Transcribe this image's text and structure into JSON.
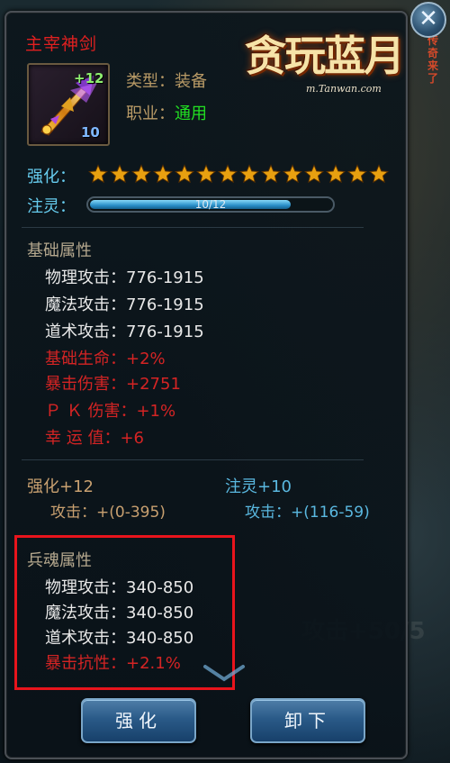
{
  "close_glyph": "✕",
  "logo": {
    "main": "贪玩蓝月",
    "url": "m.Tanwan.com",
    "side": "传奇来了"
  },
  "item": {
    "name": "主宰神剑",
    "enhance_badge": "+12",
    "level_badge": "10",
    "type_label": "类型：",
    "type_value": "装备",
    "class_label": "职业：",
    "class_value": "通用"
  },
  "enhance": {
    "label": "强化：",
    "stars": 14,
    "star_color": "#e8a010"
  },
  "infuse": {
    "label": "注灵：",
    "progress_text": "10/12",
    "progress": 0.833
  },
  "base_section": {
    "title": "基础属性",
    "base_attrs": [
      {
        "label": "物理攻击：",
        "value": "776-1915"
      },
      {
        "label": "魔法攻击：",
        "value": "776-1915"
      },
      {
        "label": "道术攻击：",
        "value": "776-1915"
      }
    ],
    "bonus_attrs": [
      {
        "label": "基础生命：",
        "value": "+2%"
      },
      {
        "label": "暴击伤害：",
        "value": "+2751"
      },
      {
        "label": "Ｐ Ｋ 伤害：",
        "value": "+1%"
      },
      {
        "label": "幸 运 值：",
        "value": "+6"
      }
    ]
  },
  "bonus": {
    "enhance_head": "强化+12",
    "enhance_line": "攻击：+(0-395)",
    "infuse_head": "注灵+10",
    "infuse_line": "攻击：+(116-59)"
  },
  "soul_section": {
    "title": "兵魂属性",
    "attrs": [
      {
        "label": "物理攻击：",
        "value": "340-850"
      },
      {
        "label": "魔法攻击：",
        "value": "340-850"
      },
      {
        "label": "道术攻击：",
        "value": "340-850"
      }
    ],
    "crit": {
      "label": "暴击抗性：",
      "value": "+2.1%"
    }
  },
  "buttons": {
    "enhance": "强化",
    "unequip": "卸下"
  },
  "colors": {
    "highlight_box": "#e8141c",
    "bonus_red": "#d42424",
    "class_green": "#22e022"
  }
}
